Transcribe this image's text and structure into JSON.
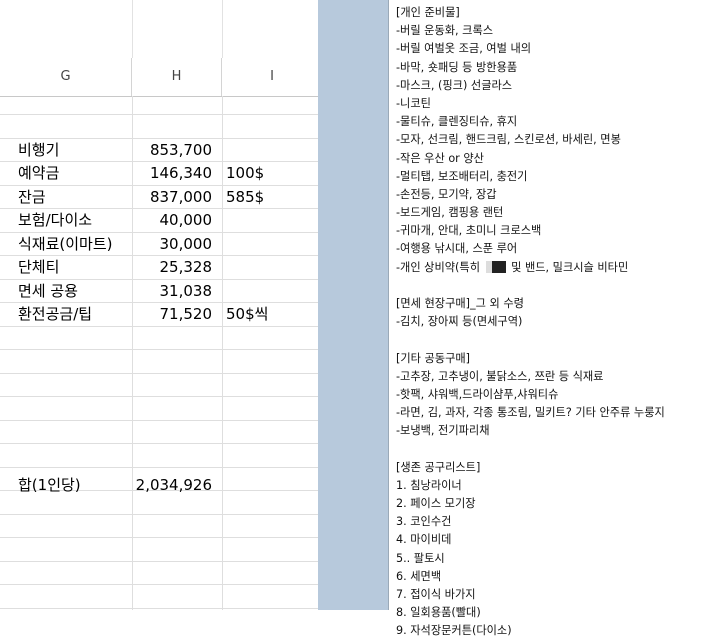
{
  "spreadsheet": {
    "columns": [
      "G",
      "H",
      "I"
    ],
    "rows": [
      {
        "label": "비행기",
        "amount": "853,700",
        "note": ""
      },
      {
        "label": "예약금",
        "amount": "146,340",
        "note": "100$"
      },
      {
        "label": "잔금",
        "amount": "837,000",
        "note": "585$"
      },
      {
        "label": "보험/다이소",
        "amount": "40,000",
        "note": ""
      },
      {
        "label": "식재료(이마트)",
        "amount": "30,000",
        "note": ""
      },
      {
        "label": "단체티",
        "amount": "25,328",
        "note": ""
      },
      {
        "label": "면세 공용",
        "amount": "31,038",
        "note": ""
      },
      {
        "label": "환전공금/팁",
        "amount": "71,520",
        "note": "50$씩"
      }
    ],
    "total": {
      "label": "합(1인당)",
      "amount": "2,034,926"
    }
  },
  "note": {
    "lines": [
      "[개인 준비물]",
      "-버릴 운동화, 크록스",
      "-버릴 여벌옷 조금, 여벌 내의",
      "-바막, 숏패딩 등 방한용품",
      "-마스크, (핑크) 선글라스",
      "-니코틴",
      "-물티슈, 클렌징티슈, 휴지",
      "-모자, 선크림, 핸드크림, 스킨로션, 바세린, 면봉",
      "-작은 우산 or 양산",
      "-멀티탭, 보조배터리, 충전기",
      "-손전등, 모기약, 장갑",
      "-보드게임, 캠핑용 랜턴",
      "-귀마개, 안대, 초미니 크로스백",
      "-여행용 낚시대, 스푼 루어",
      "-개인 상비약(특히 ",
      "",
      "[면세 현장구매]_그 외 수령",
      "-김치, 장아찌 등(면세구역)",
      "",
      "[기타 공동구매]",
      "-고추장, 고추냉이, 불닭소스, 쯔란 등 식재료",
      "-핫팩, 샤워백,드라이샴푸,샤워티슈",
      "-라면, 김, 과자, 각종 통조림, 밀키트? 기타 안주류 누룽지",
      "-보냉백, 전기파리채",
      "",
      "[생존 공구리스트]",
      "1. 침낭라이너",
      "2. 페이스 모기장",
      "3. 코인수건",
      "4. 마이비데",
      "5.. 팔토시",
      "6. 세면백",
      "7. 접이식 바가지",
      "8. 일회용품(빨대)",
      "9. 자석장문커튼(다이소)"
    ],
    "medicine_suffix": " 및 밴드, 밀크시슬 비타민"
  }
}
